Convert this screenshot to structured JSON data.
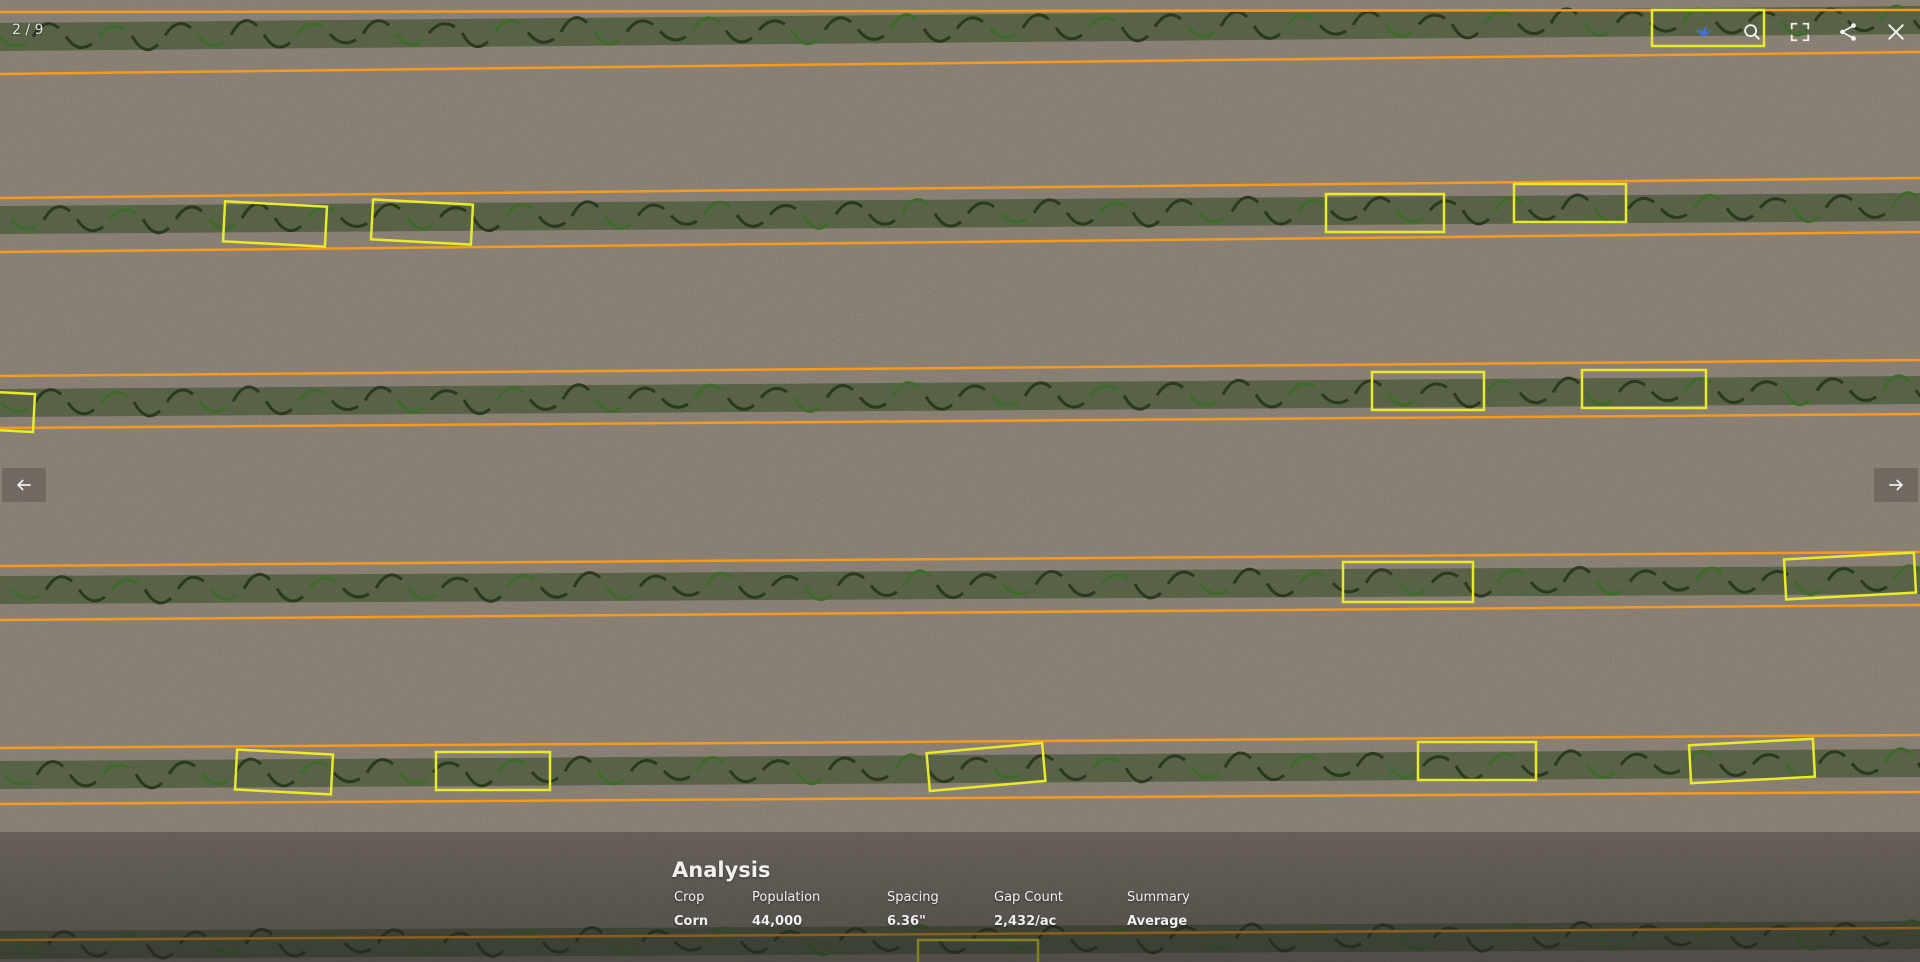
{
  "viewer": {
    "counter": "2 / 9",
    "toolbar": {
      "icons": [
        "bird-icon",
        "zoom-icon",
        "fullscreen-icon",
        "share-icon",
        "close-icon"
      ]
    },
    "nav": {
      "prev_icon": "arrow-left-icon",
      "next_icon": "arrow-right-icon"
    }
  },
  "caption": {
    "title": "Analysis",
    "stats": [
      {
        "label": "Crop",
        "value": "Corn"
      },
      {
        "label": "Population",
        "value": "44,000"
      },
      {
        "label": "Spacing",
        "value": "6.36\""
      },
      {
        "label": "Gap Count",
        "value": "2,432/ac"
      },
      {
        "label": "Summary",
        "value": "Average"
      }
    ]
  },
  "colors": {
    "soil": "#8f8579",
    "row_line": "#f39a1f",
    "gap_box": "#e8ea2a",
    "plant": "#2f4a22"
  }
}
